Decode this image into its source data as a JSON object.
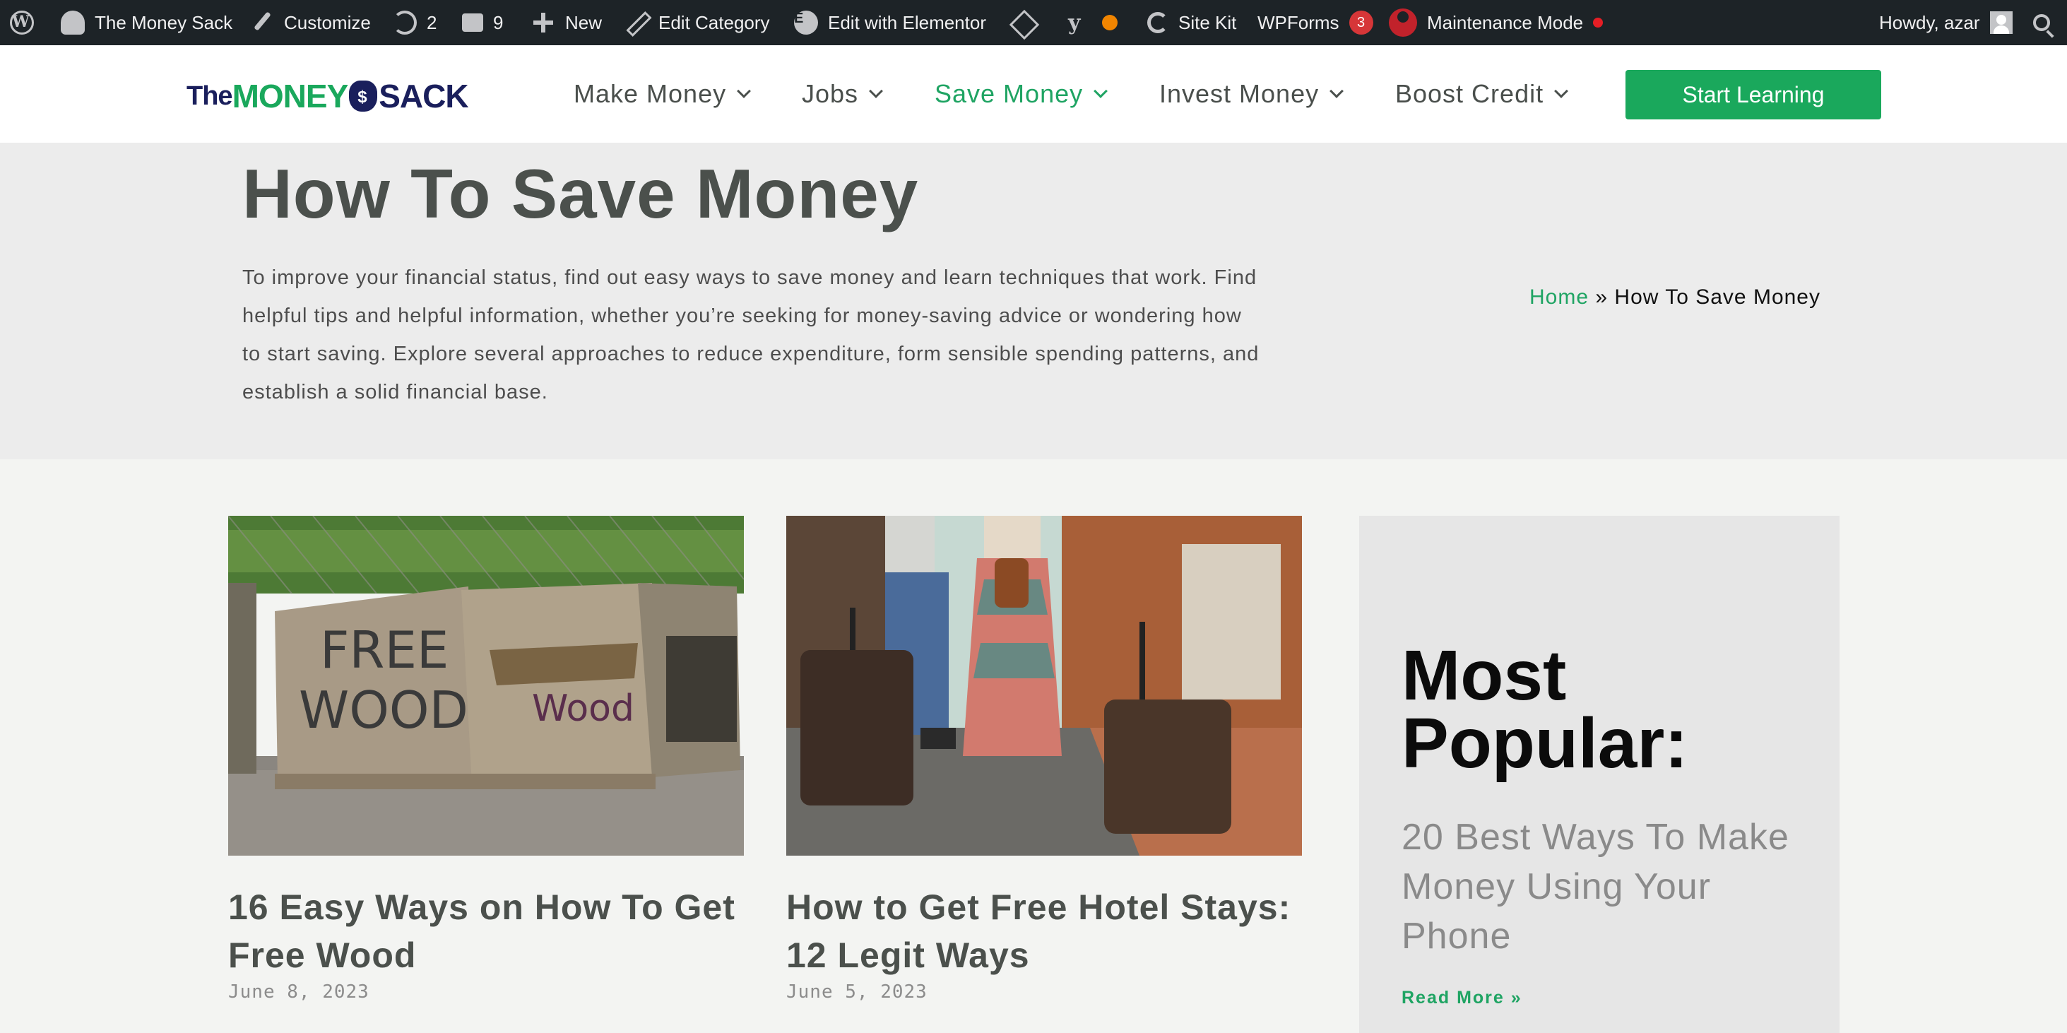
{
  "adminbar": {
    "site_name": "The Money Sack",
    "customize": "Customize",
    "updates_count": "2",
    "comments_count": "9",
    "new_label": "New",
    "edit_category": "Edit Category",
    "elementor": "Edit with Elementor",
    "sitekit": "Site Kit",
    "wpforms": "WPForms",
    "wpforms_count": "3",
    "maintenance": "Maintenance Mode",
    "howdy": "Howdy, azar"
  },
  "header": {
    "logo_the": "The",
    "logo_money": "MONEY",
    "logo_sack": "SACK",
    "nav": [
      {
        "label": "Make Money"
      },
      {
        "label": "Jobs"
      },
      {
        "label": "Save Money"
      },
      {
        "label": "Invest Money"
      },
      {
        "label": "Boost Credit"
      }
    ],
    "cta": "Start Learning"
  },
  "hero": {
    "title": "How To Save Money",
    "description": "To improve your financial status, find out easy ways to save money and learn techniques that work. Find helpful tips and helpful information, whether you’re seeking for money-saving advice or wondering how to start saving. Explore several approaches to reduce expenditure, form sensible spending patterns, and establish a solid financial base.",
    "breadcrumb_home": "Home",
    "breadcrumb_sep": "»",
    "breadcrumb_current": "How To Save Money"
  },
  "posts": [
    {
      "title": "16 Easy Ways on How To Get Free Wood",
      "date": "June 8, 2023",
      "image_text_1": "FREE",
      "image_text_2": "WOOD",
      "image_text_3": "Wood"
    },
    {
      "title": "How to Get Free Hotel Stays: 12 Legit Ways",
      "date": "June 5, 2023"
    }
  ],
  "sidebar": {
    "heading": "Most Popular:",
    "article": "20 Best Ways To Make Money Using Your Phone",
    "read_more": "Read More »"
  },
  "colors": {
    "accent": "#1fa463",
    "adminbar": "#1d2327",
    "hero_bg": "#ececec"
  }
}
